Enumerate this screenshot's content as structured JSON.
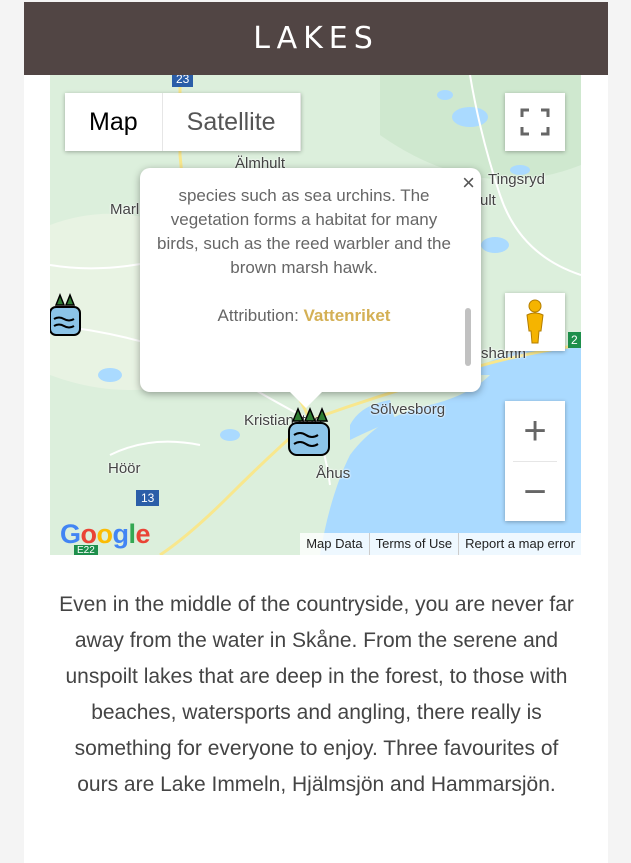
{
  "header": {
    "title": "LAKES"
  },
  "map": {
    "type_controls": [
      "Map",
      "Satellite"
    ],
    "active_type": "Map",
    "places": {
      "almhult": "Älmhult",
      "tingsryd": "Tingsryd",
      "marl": "Marl",
      "ult": "ult",
      "hamn": "shamn",
      "kristianstad": "Kristianstad",
      "solvesborg": "Sölvesborg",
      "ahus": "Åhus",
      "hoor": "Höör"
    },
    "road_badges": {
      "r23": "23",
      "r13": "13",
      "r2": "2",
      "e22": "E22"
    },
    "popup": {
      "text": "species such as sea urchins. The vegetation forms a habitat for many birds, such as the reed warbler and the brown marsh hawk.",
      "attribution_label": "Attribution:",
      "attribution_link": "Vattenriket",
      "close": "×"
    },
    "footer": {
      "google": "Google",
      "map_data": "Map Data",
      "terms": "Terms of Use",
      "report": "Report a map error"
    },
    "zoom_in": "+",
    "zoom_out": "−"
  },
  "description": "Even in the middle of the countryside, you are never far away from the water in Skåne. From the serene and unspoilt lakes that are deep in the forest, to those with beaches, watersports and angling, there really is something for everyone to enjoy. Three favourites of ours are Lake Immeln, Hjälmsjön and Hammarsjön.",
  "colors": {
    "header_bg": "#514544",
    "attribution_link": "#d4b055",
    "water": "#aadaff",
    "land": "#dcefdc"
  },
  "icons": [
    "fullscreen-icon",
    "pegman-icon",
    "lake-marker-icon",
    "close-icon"
  ]
}
